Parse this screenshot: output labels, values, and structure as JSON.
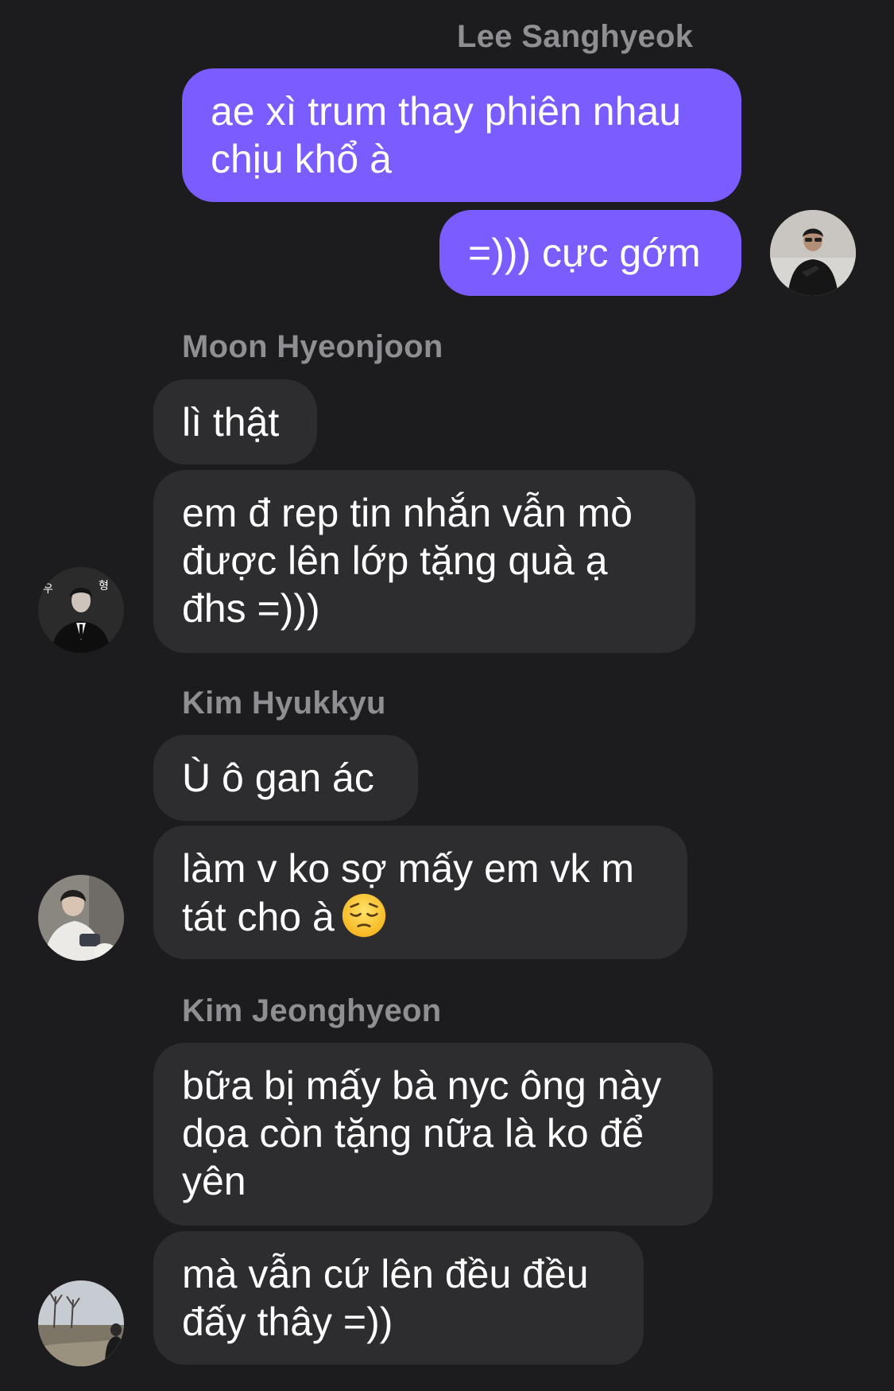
{
  "colors": {
    "background": "#1c1c1e",
    "outgoing_bubble": "#7b5cff",
    "incoming_bubble": "#2d2d30",
    "sender_name": "#8e8e93",
    "text": "#ffffff"
  },
  "messages": [
    {
      "sender": "Lee Sanghyeok",
      "bubbles": [
        "ae xì trum thay phiên nhau\nchịu khổ à",
        "=))) cực gớm"
      ]
    },
    {
      "sender": "Moon Hyeonjoon",
      "bubbles": [
        "lì thật",
        "em đ rep tin nhắn vẫn mò\nđược lên lớp tặng quà ạ\nđhs =)))"
      ]
    },
    {
      "sender": "Kim Hyukkyu",
      "bubbles": [
        "Ù ô gan ác",
        "làm v ko sợ mấy em vk m\ntát cho à"
      ],
      "emoji": "pensive-face"
    },
    {
      "sender": "Kim Jeonghyeon",
      "bubbles": [
        "bữa bị mấy bà nyc ông này\ndọa còn tặng nữa là ko để\nyên",
        "mà vẫn cứ lên đều đều\nđấy thây =))"
      ]
    }
  ],
  "avatars": [
    {
      "person": "Lee Sanghyeok",
      "icon": "avatar-photo"
    },
    {
      "person": "Moon Hyeonjoon",
      "icon": "avatar-photo"
    },
    {
      "person": "Kim Hyukkyu",
      "icon": "avatar-photo"
    },
    {
      "person": "Kim Jeonghyeon",
      "icon": "avatar-photo"
    }
  ]
}
